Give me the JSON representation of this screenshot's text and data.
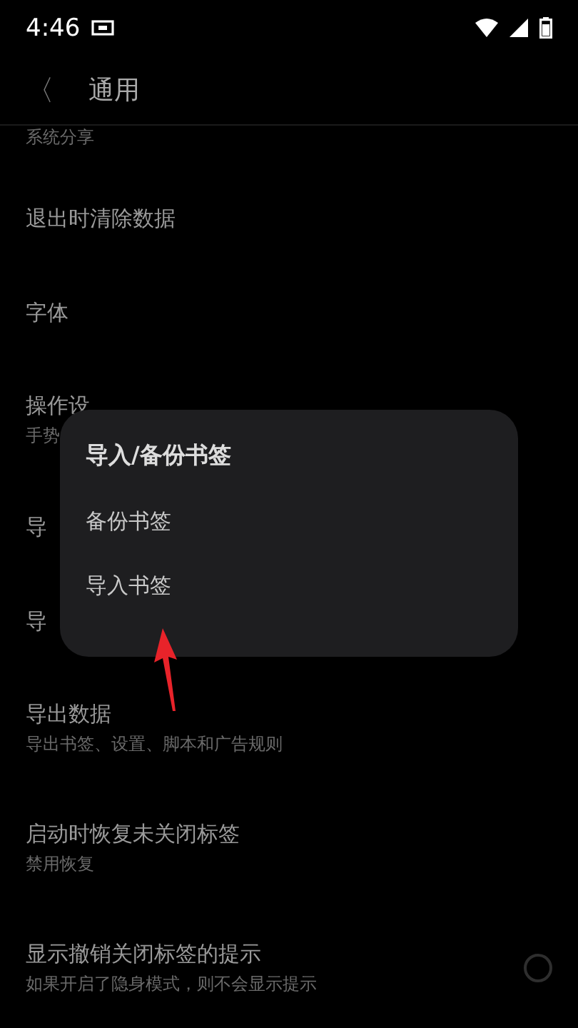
{
  "status_bar": {
    "time": "4:46"
  },
  "header": {
    "back": "〈",
    "title": "通用"
  },
  "settings": [
    {
      "kind": "text",
      "subtitle": "系统分享"
    },
    {
      "kind": "text",
      "title": "退出时清除数据"
    },
    {
      "kind": "text",
      "title": "字体"
    },
    {
      "kind": "text",
      "title": "操作设",
      "subtitle": "手势"
    },
    {
      "kind": "text",
      "title": "导"
    },
    {
      "kind": "text",
      "title": "导"
    },
    {
      "kind": "text",
      "title": "导出数据",
      "subtitle": "导出书签、设置、脚本和广告规则"
    },
    {
      "kind": "text",
      "title": "启动时恢复未关闭标签",
      "subtitle": "禁用恢复"
    },
    {
      "kind": "toggle",
      "title": "显示撤销关闭标签的提示",
      "subtitle": "如果开启了隐身模式，则不会显示提示",
      "checked": false
    }
  ],
  "dialog": {
    "title": "导入/备份书签",
    "options": [
      "备份书签",
      "导入书签"
    ]
  }
}
